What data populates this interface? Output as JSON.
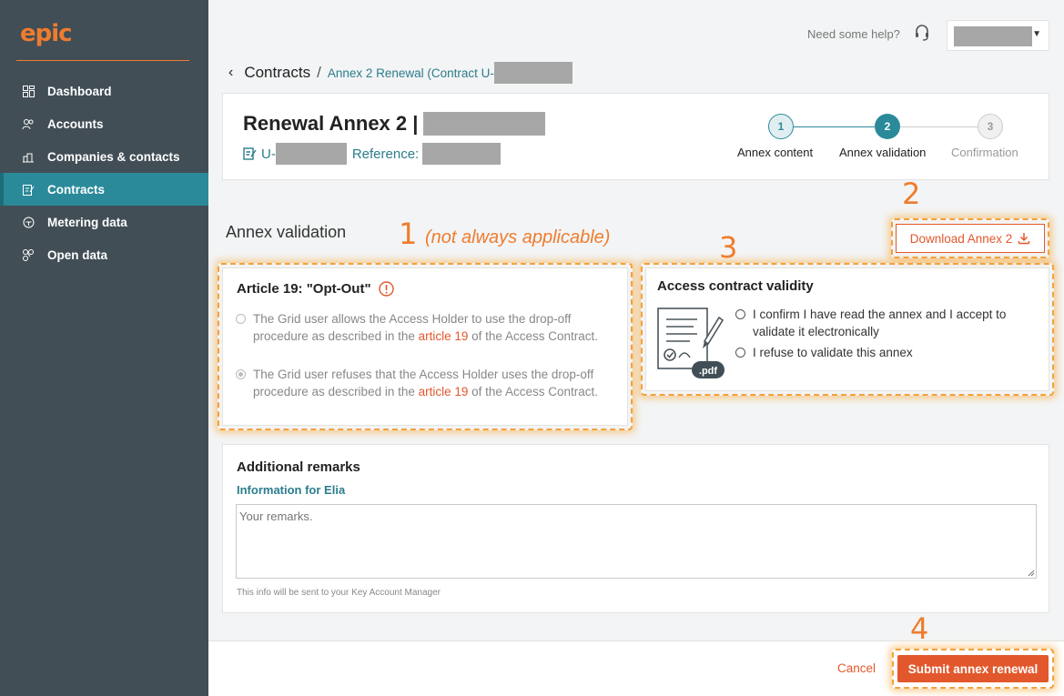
{
  "app": {
    "logo": "epic"
  },
  "sidebar": {
    "items": [
      {
        "label": "Dashboard",
        "icon": "dashboard-icon"
      },
      {
        "label": "Accounts",
        "icon": "users-icon"
      },
      {
        "label": "Companies & contacts",
        "icon": "building-icon"
      },
      {
        "label": "Contracts",
        "icon": "contract-icon",
        "active": true
      },
      {
        "label": "Metering data",
        "icon": "meter-icon"
      },
      {
        "label": "Open data",
        "icon": "share-icon"
      }
    ]
  },
  "topbar": {
    "help_text": "Need some help?"
  },
  "breadcrumb": {
    "root": "Contracts",
    "separator": "/",
    "current": "Annex 2 Renewal (Contract U-"
  },
  "header": {
    "title": "Renewal Annex 2 |",
    "id_prefix": "U-",
    "reference_label": "Reference:"
  },
  "stepper": {
    "steps": [
      {
        "number": "1",
        "label": "Annex content",
        "state": "done"
      },
      {
        "number": "2",
        "label": "Annex validation",
        "state": "active"
      },
      {
        "number": "3",
        "label": "Confirmation",
        "state": "pending"
      }
    ]
  },
  "section": {
    "title": "Annex validation"
  },
  "annotations": {
    "n1": "1",
    "note1": "(not always applicable)",
    "n2": "2",
    "n3": "3",
    "n4": "4",
    "highlight_color": "#f4a13c"
  },
  "download": {
    "label": "Download Annex 2"
  },
  "article": {
    "title": "Article 19: \"Opt-Out\"",
    "options": [
      {
        "pre": "The Grid user allows the Access Holder to use the drop-off procedure as described in the ",
        "link": "article 19",
        "post": " of the Access Contract.",
        "checked": false
      },
      {
        "pre": "The Grid user refuses that the Access Holder uses the drop-off procedure as described in the ",
        "link": "article 19",
        "post": " of the Access Contract.",
        "checked": true
      }
    ]
  },
  "validity": {
    "title": "Access contract validity",
    "pdf_label": ".pdf",
    "options": [
      {
        "label": "I confirm I have read the annex and I accept to validate it electronically"
      },
      {
        "label": "I refuse to validate this annex"
      }
    ]
  },
  "remarks": {
    "title": "Additional remarks",
    "subtitle": "Information for Elia",
    "placeholder": "Your remarks.",
    "note": "This info will be sent to your Key Account Manager"
  },
  "footer": {
    "cancel_label": "Cancel",
    "submit_label": "Submit annex renewal"
  },
  "colors": {
    "teal": "#2b8a9a",
    "orange": "#e2582c",
    "sidebar": "#424e56"
  }
}
